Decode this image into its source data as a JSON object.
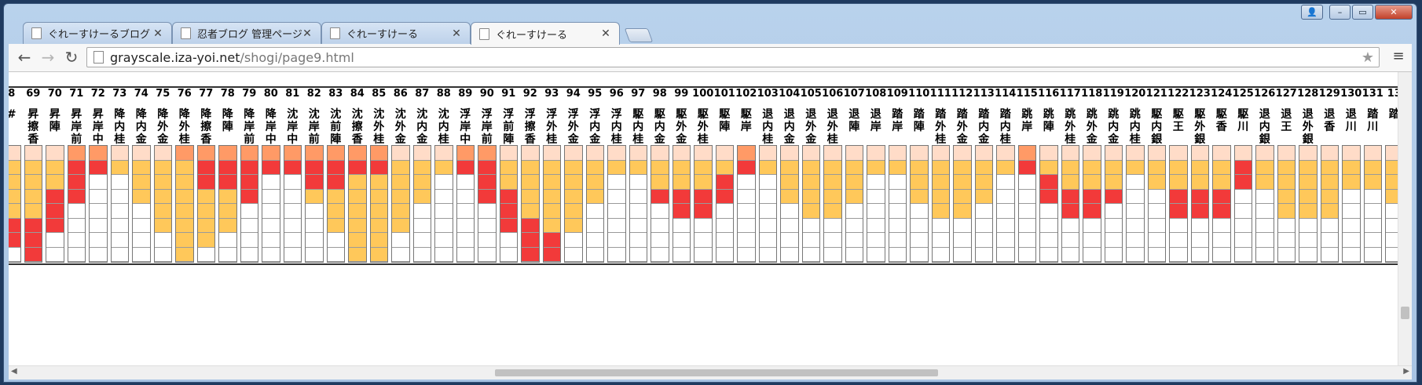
{
  "browser": {
    "tabs": [
      {
        "title": "ぐれーすけーるブログ",
        "active": false
      },
      {
        "title": "忍者ブログ 管理ページ -",
        "active": false
      },
      {
        "title": "ぐれーすけーる",
        "active": false
      },
      {
        "title": "ぐれーすけーる",
        "active": true
      }
    ],
    "url_host": "grayscale.iza-yoi.net",
    "url_path": "/shogi/page9.html",
    "icons": {
      "back": "back-arrow-icon",
      "forward": "forward-arrow-icon",
      "reload": "reload-icon",
      "star": "bookmark-star-icon",
      "menu": "menu-icon"
    },
    "winctrls": {
      "minimize": "–",
      "maximize": "▭",
      "close": "✕"
    }
  },
  "table": {
    "columns": [
      {
        "num": "8",
        "name": "#",
        "cells": [
          "pink",
          "yellow",
          "yellow",
          "yellow",
          "yellow",
          "red",
          "red",
          "white"
        ]
      },
      {
        "num": "69",
        "name": "昇擦香",
        "cells": [
          "pink",
          "yellow",
          "yellow",
          "yellow",
          "yellow",
          "red",
          "red",
          "red"
        ]
      },
      {
        "num": "70",
        "name": "昇陣",
        "cells": [
          "pink",
          "yellow",
          "yellow",
          "red",
          "red",
          "red",
          "white",
          "white"
        ]
      },
      {
        "num": "71",
        "name": "昇岸前",
        "cells": [
          "orange",
          "red",
          "red",
          "red",
          "white",
          "white",
          "white",
          "white"
        ]
      },
      {
        "num": "72",
        "name": "昇岸中",
        "cells": [
          "orange",
          "red",
          "white",
          "white",
          "white",
          "white",
          "white",
          "white"
        ]
      },
      {
        "num": "73",
        "name": "降内桂",
        "cells": [
          "pink",
          "yellow",
          "white",
          "white",
          "white",
          "white",
          "white",
          "white"
        ]
      },
      {
        "num": "74",
        "name": "降内金",
        "cells": [
          "pink",
          "yellow",
          "yellow",
          "yellow",
          "white",
          "white",
          "white",
          "white"
        ]
      },
      {
        "num": "75",
        "name": "降外金",
        "cells": [
          "pink",
          "yellow",
          "yellow",
          "yellow",
          "yellow",
          "yellow",
          "white",
          "white"
        ]
      },
      {
        "num": "76",
        "name": "降外桂",
        "cells": [
          "orange",
          "yellow",
          "yellow",
          "yellow",
          "yellow",
          "yellow",
          "yellow",
          "yellow"
        ]
      },
      {
        "num": "77",
        "name": "降擦香",
        "cells": [
          "orange",
          "red",
          "red",
          "yellow",
          "yellow",
          "yellow",
          "yellow",
          "white"
        ]
      },
      {
        "num": "78",
        "name": "降陣",
        "cells": [
          "orange",
          "red",
          "red",
          "yellow",
          "yellow",
          "yellow",
          "white",
          "white"
        ]
      },
      {
        "num": "79",
        "name": "降岸前",
        "cells": [
          "orange",
          "red",
          "red",
          "red",
          "white",
          "white",
          "white",
          "white"
        ]
      },
      {
        "num": "80",
        "name": "降岸中",
        "cells": [
          "orange",
          "red",
          "white",
          "white",
          "white",
          "white",
          "white",
          "white"
        ]
      },
      {
        "num": "81",
        "name": "沈岸中",
        "cells": [
          "orange",
          "red",
          "white",
          "white",
          "white",
          "white",
          "white",
          "white"
        ]
      },
      {
        "num": "82",
        "name": "沈岸前",
        "cells": [
          "orange",
          "red",
          "red",
          "yellow",
          "white",
          "white",
          "white",
          "white"
        ]
      },
      {
        "num": "83",
        "name": "沈前陣",
        "cells": [
          "orange",
          "red",
          "red",
          "yellow",
          "yellow",
          "yellow",
          "white",
          "white"
        ]
      },
      {
        "num": "84",
        "name": "沈擦香",
        "cells": [
          "orange",
          "red",
          "yellow",
          "yellow",
          "yellow",
          "yellow",
          "yellow",
          "yellow"
        ]
      },
      {
        "num": "85",
        "name": "沈外桂",
        "cells": [
          "orange",
          "red",
          "yellow",
          "yellow",
          "yellow",
          "yellow",
          "yellow",
          "yellow"
        ]
      },
      {
        "num": "86",
        "name": "沈外金",
        "cells": [
          "pink",
          "yellow",
          "yellow",
          "yellow",
          "yellow",
          "yellow",
          "white",
          "white"
        ]
      },
      {
        "num": "87",
        "name": "沈内金",
        "cells": [
          "pink",
          "yellow",
          "yellow",
          "yellow",
          "white",
          "white",
          "white",
          "white"
        ]
      },
      {
        "num": "88",
        "name": "沈内桂",
        "cells": [
          "pink",
          "yellow",
          "white",
          "white",
          "white",
          "white",
          "white",
          "white"
        ]
      },
      {
        "num": "89",
        "name": "浮岸中",
        "cells": [
          "orange",
          "red",
          "white",
          "white",
          "white",
          "white",
          "white",
          "white"
        ]
      },
      {
        "num": "90",
        "name": "浮岸前",
        "cells": [
          "orange",
          "red",
          "red",
          "red",
          "white",
          "white",
          "white",
          "white"
        ]
      },
      {
        "num": "91",
        "name": "浮前陣",
        "cells": [
          "pink",
          "yellow",
          "yellow",
          "red",
          "red",
          "red",
          "white",
          "white"
        ]
      },
      {
        "num": "92",
        "name": "浮擦香",
        "cells": [
          "pink",
          "yellow",
          "yellow",
          "yellow",
          "yellow",
          "red",
          "red",
          "red"
        ]
      },
      {
        "num": "93",
        "name": "浮外桂",
        "cells": [
          "pink",
          "yellow",
          "yellow",
          "yellow",
          "yellow",
          "yellow",
          "red",
          "red"
        ]
      },
      {
        "num": "94",
        "name": "浮外金",
        "cells": [
          "pink",
          "yellow",
          "yellow",
          "yellow",
          "yellow",
          "yellow",
          "white",
          "white"
        ]
      },
      {
        "num": "95",
        "name": "浮内金",
        "cells": [
          "pink",
          "yellow",
          "yellow",
          "yellow",
          "white",
          "white",
          "white",
          "white"
        ]
      },
      {
        "num": "96",
        "name": "浮内桂",
        "cells": [
          "pink",
          "yellow",
          "white",
          "white",
          "white",
          "white",
          "white",
          "white"
        ]
      },
      {
        "num": "97",
        "name": "駆内桂",
        "cells": [
          "pink",
          "yellow",
          "white",
          "white",
          "white",
          "white",
          "white",
          "white"
        ]
      },
      {
        "num": "98",
        "name": "駆内金",
        "cells": [
          "pink",
          "yellow",
          "yellow",
          "red",
          "white",
          "white",
          "white",
          "white"
        ]
      },
      {
        "num": "99",
        "name": "駆外金",
        "cells": [
          "pink",
          "yellow",
          "yellow",
          "red",
          "red",
          "white",
          "white",
          "white"
        ]
      },
      {
        "num": "100",
        "name": "駆外桂",
        "cells": [
          "pink",
          "yellow",
          "yellow",
          "red",
          "red",
          "white",
          "white",
          "white"
        ]
      },
      {
        "num": "101",
        "name": "駆陣",
        "cells": [
          "pink",
          "yellow",
          "red",
          "red",
          "white",
          "white",
          "white",
          "white"
        ]
      },
      {
        "num": "102",
        "name": "駆岸",
        "cells": [
          "orange",
          "red",
          "white",
          "white",
          "white",
          "white",
          "white",
          "white"
        ]
      },
      {
        "num": "103",
        "name": "退内桂",
        "cells": [
          "pink",
          "yellow",
          "white",
          "white",
          "white",
          "white",
          "white",
          "white"
        ]
      },
      {
        "num": "104",
        "name": "退内金",
        "cells": [
          "pink",
          "yellow",
          "yellow",
          "yellow",
          "white",
          "white",
          "white",
          "white"
        ]
      },
      {
        "num": "105",
        "name": "退外金",
        "cells": [
          "pink",
          "yellow",
          "yellow",
          "yellow",
          "yellow",
          "white",
          "white",
          "white"
        ]
      },
      {
        "num": "106",
        "name": "退外桂",
        "cells": [
          "pink",
          "yellow",
          "yellow",
          "yellow",
          "yellow",
          "white",
          "white",
          "white"
        ]
      },
      {
        "num": "107",
        "name": "退陣",
        "cells": [
          "pink",
          "yellow",
          "yellow",
          "yellow",
          "white",
          "white",
          "white",
          "white"
        ]
      },
      {
        "num": "108",
        "name": "退岸",
        "cells": [
          "pink",
          "yellow",
          "white",
          "white",
          "white",
          "white",
          "white",
          "white"
        ]
      },
      {
        "num": "109",
        "name": "踏岸",
        "cells": [
          "pink",
          "yellow",
          "white",
          "white",
          "white",
          "white",
          "white",
          "white"
        ]
      },
      {
        "num": "110",
        "name": "踏陣",
        "cells": [
          "pink",
          "yellow",
          "yellow",
          "yellow",
          "white",
          "white",
          "white",
          "white"
        ]
      },
      {
        "num": "111",
        "name": "踏外桂",
        "cells": [
          "pink",
          "yellow",
          "yellow",
          "yellow",
          "yellow",
          "white",
          "white",
          "white"
        ]
      },
      {
        "num": "112",
        "name": "踏外金",
        "cells": [
          "pink",
          "yellow",
          "yellow",
          "yellow",
          "yellow",
          "white",
          "white",
          "white"
        ]
      },
      {
        "num": "113",
        "name": "踏内金",
        "cells": [
          "pink",
          "yellow",
          "yellow",
          "yellow",
          "white",
          "white",
          "white",
          "white"
        ]
      },
      {
        "num": "114",
        "name": "踏内桂",
        "cells": [
          "pink",
          "yellow",
          "white",
          "white",
          "white",
          "white",
          "white",
          "white"
        ]
      },
      {
        "num": "115",
        "name": "跳岸",
        "cells": [
          "orange",
          "red",
          "white",
          "white",
          "white",
          "white",
          "white",
          "white"
        ]
      },
      {
        "num": "116",
        "name": "跳陣",
        "cells": [
          "pink",
          "yellow",
          "red",
          "red",
          "white",
          "white",
          "white",
          "white"
        ]
      },
      {
        "num": "117",
        "name": "跳外桂",
        "cells": [
          "pink",
          "yellow",
          "yellow",
          "red",
          "red",
          "white",
          "white",
          "white"
        ]
      },
      {
        "num": "118",
        "name": "跳外金",
        "cells": [
          "pink",
          "yellow",
          "yellow",
          "red",
          "red",
          "white",
          "white",
          "white"
        ]
      },
      {
        "num": "119",
        "name": "跳内金",
        "cells": [
          "pink",
          "yellow",
          "yellow",
          "red",
          "white",
          "white",
          "white",
          "white"
        ]
      },
      {
        "num": "120",
        "name": "跳内桂",
        "cells": [
          "pink",
          "yellow",
          "white",
          "white",
          "white",
          "white",
          "white",
          "white"
        ]
      },
      {
        "num": "121",
        "name": "駆内銀",
        "cells": [
          "pink",
          "yellow",
          "yellow",
          "white",
          "white",
          "white",
          "white",
          "white"
        ]
      },
      {
        "num": "122",
        "name": "駆王",
        "cells": [
          "pink",
          "yellow",
          "yellow",
          "red",
          "red",
          "white",
          "white",
          "white"
        ]
      },
      {
        "num": "123",
        "name": "駆外銀",
        "cells": [
          "pink",
          "yellow",
          "yellow",
          "red",
          "red",
          "white",
          "white",
          "white"
        ]
      },
      {
        "num": "124",
        "name": "駆香",
        "cells": [
          "pink",
          "yellow",
          "yellow",
          "red",
          "red",
          "white",
          "white",
          "white"
        ]
      },
      {
        "num": "125",
        "name": "駆川",
        "cells": [
          "pink",
          "red",
          "red",
          "white",
          "white",
          "white",
          "white",
          "white"
        ]
      },
      {
        "num": "126",
        "name": "退内銀",
        "cells": [
          "pink",
          "yellow",
          "yellow",
          "white",
          "white",
          "white",
          "white",
          "white"
        ]
      },
      {
        "num": "127",
        "name": "退王",
        "cells": [
          "pink",
          "yellow",
          "yellow",
          "yellow",
          "yellow",
          "white",
          "white",
          "white"
        ]
      },
      {
        "num": "128",
        "name": "退外銀",
        "cells": [
          "pink",
          "yellow",
          "yellow",
          "yellow",
          "yellow",
          "white",
          "white",
          "white"
        ]
      },
      {
        "num": "129",
        "name": "退香",
        "cells": [
          "pink",
          "yellow",
          "yellow",
          "yellow",
          "yellow",
          "white",
          "white",
          "white"
        ]
      },
      {
        "num": "130",
        "name": "退川",
        "cells": [
          "pink",
          "yellow",
          "yellow",
          "white",
          "white",
          "white",
          "white",
          "white"
        ]
      },
      {
        "num": "131",
        "name": "踏川",
        "cells": [
          "pink",
          "yellow",
          "yellow",
          "white",
          "white",
          "white",
          "white",
          "white"
        ]
      },
      {
        "num": "13",
        "name": "踏",
        "cells": [
          "pink",
          "yellow",
          "yellow",
          "yellow",
          "white",
          "white",
          "white",
          "white"
        ]
      }
    ]
  }
}
